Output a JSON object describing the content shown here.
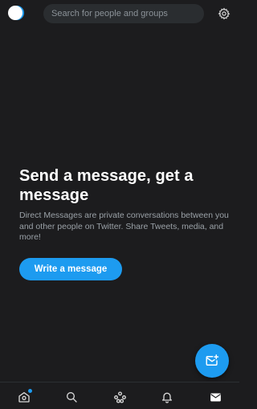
{
  "header": {
    "search_placeholder": "Search for people and groups",
    "avatar_icon": "profile-avatar",
    "settings_icon": "gear-icon"
  },
  "empty_state": {
    "title": "Send a message, get a message",
    "body": "Direct Messages are private conversations between you and other people on Twitter. Share Tweets, media, and more!",
    "button_label": "Write a message"
  },
  "fab": {
    "icon": "new-message-icon"
  },
  "bottom_nav": {
    "items": [
      {
        "name": "home",
        "icon": "home-icon",
        "has_dot": true
      },
      {
        "name": "search",
        "icon": "search-icon"
      },
      {
        "name": "spaces",
        "icon": "spaces-icon"
      },
      {
        "name": "notifications",
        "icon": "bell-icon"
      },
      {
        "name": "messages",
        "icon": "mail-icon",
        "active": true
      }
    ]
  },
  "colors": {
    "background": "#1c1c1e",
    "accent": "#1d9bf0",
    "text_primary": "#ffffff",
    "text_secondary": "#9aa1a7"
  }
}
